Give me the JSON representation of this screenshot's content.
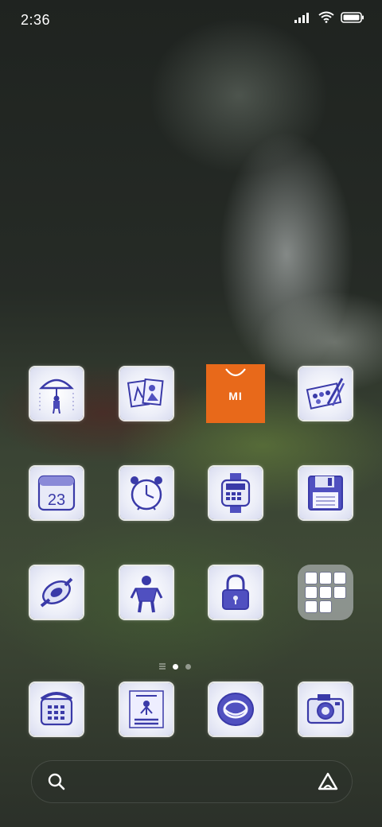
{
  "status_bar": {
    "time": "2:36",
    "icons": [
      "signal-icon",
      "wifi-icon",
      "battery-icon"
    ]
  },
  "home_screen": {
    "apps": [
      {
        "name": "umbrella-boy-app-icon",
        "icon": "umbrella-icon"
      },
      {
        "name": "gallery-app-icon",
        "icon": "photos-icon"
      },
      {
        "name": "mi-store-app-icon",
        "icon": "mi-store-icon",
        "label": "MI",
        "color": "#e8691a"
      },
      {
        "name": "themes-app-icon",
        "icon": "paint-brush-icon"
      },
      {
        "name": "calendar-app-icon",
        "icon": "calendar-icon",
        "label": "23"
      },
      {
        "name": "clock-app-icon",
        "icon": "alarm-clock-icon"
      },
      {
        "name": "calculator-app-icon",
        "icon": "calculator-watch-icon"
      },
      {
        "name": "file-manager-app-icon",
        "icon": "floppy-disk-icon"
      },
      {
        "name": "settings-app-icon",
        "icon": "gear-knob-icon"
      },
      {
        "name": "security-app-icon",
        "icon": "superhero-icon"
      },
      {
        "name": "app-lock-icon",
        "icon": "padlock-icon"
      },
      {
        "name": "app-folder",
        "icon": "folder-icon"
      }
    ],
    "page_indicator": {
      "pages": 2,
      "current": 1
    }
  },
  "dock": {
    "apps": [
      {
        "name": "phone-app-icon",
        "icon": "telephone-icon"
      },
      {
        "name": "doordarshan-app-icon",
        "icon": "tv-program-icon"
      },
      {
        "name": "browser-app-icon",
        "icon": "globe-logo-icon"
      },
      {
        "name": "camera-app-icon",
        "icon": "camera-icon"
      }
    ]
  },
  "search": {
    "icon": "search-icon",
    "assistant_icon": "assistant-icon"
  },
  "colors": {
    "ink": "#3a3aa8",
    "mi_orange": "#e8691a"
  }
}
